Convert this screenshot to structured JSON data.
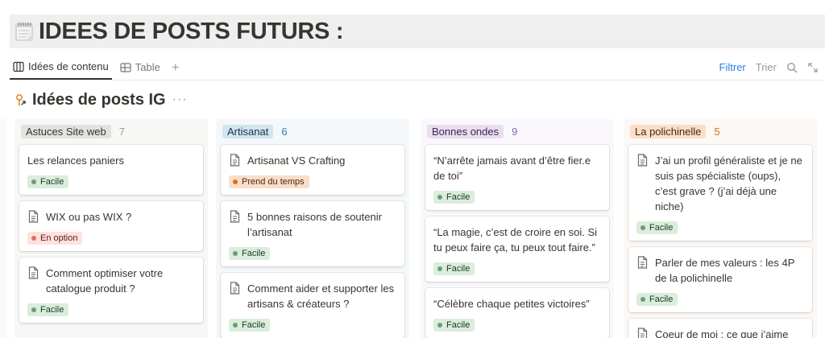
{
  "page": {
    "title": "IDEES DE POSTS FUTURS :",
    "icon": "notepad-icon"
  },
  "views": {
    "tabs": [
      {
        "label": "Idées de contenu",
        "icon": "board-icon",
        "active": true
      },
      {
        "label": "Table",
        "icon": "table-icon",
        "active": false
      }
    ],
    "add_label": "+",
    "filter_label": "Filtrer",
    "sort_label": "Trier"
  },
  "section": {
    "title": "Idées de posts IG",
    "icon": "pointer-tap-icon",
    "more": "···"
  },
  "colors": {
    "accent_blue": "#2383e2",
    "facile_bg": "#dbeddb",
    "facile_dot": "#6c9b7d",
    "option_bg": "#ffe2dd",
    "option_dot": "#e16f64",
    "temps_bg": "#fadec9",
    "temps_dot": "#d9730d"
  },
  "columns": [
    {
      "label": "Astuces Site web",
      "count": "7",
      "label_bg": "#e3e2e0",
      "label_color": "#37352f",
      "count_color": "#9b9a97",
      "bg": "#f7f7f5",
      "cards": [
        {
          "title": "Les relances paniers",
          "doc": false,
          "tag": "Facile",
          "tag_type": "facile"
        },
        {
          "title": "WIX ou pas WIX ?",
          "doc": true,
          "tag": "En option",
          "tag_type": "option"
        },
        {
          "title": "Comment optimiser votre catalogue produit ?",
          "doc": true,
          "tag": "Facile",
          "tag_type": "facile"
        }
      ]
    },
    {
      "label": "Artisanat",
      "count": "6",
      "label_bg": "#d3e5ef",
      "label_color": "#183347",
      "count_color": "#337ea9",
      "bg": "#f4f8fa",
      "cards": [
        {
          "title": "Artisanat VS Crafting",
          "doc": true,
          "tag": "Prend du temps",
          "tag_type": "temps"
        },
        {
          "title": "5 bonnes raisons de soutenir l’artisanat",
          "doc": true,
          "tag": "Facile",
          "tag_type": "facile"
        },
        {
          "title": "Comment aider et supporter les artisans & créateurs ?",
          "doc": true,
          "tag": "Facile",
          "tag_type": "facile"
        }
      ]
    },
    {
      "label": "Bonnes ondes",
      "count": "9",
      "label_bg": "#e8deee",
      "label_color": "#412454",
      "count_color": "#9065b0",
      "bg": "#faf8fc",
      "cards": [
        {
          "title": "“N’arrête jamais avant d’être fier.e de toi”",
          "doc": false,
          "tag": "Facile",
          "tag_type": "facile"
        },
        {
          "title": "“La magie, c’est de croire en soi. Si tu peux faire ça, tu peux tout faire.”",
          "doc": false,
          "tag": "Facile",
          "tag_type": "facile"
        },
        {
          "title": "“Célèbre chaque petites victoires”",
          "doc": false,
          "tag": "Facile",
          "tag_type": "facile"
        }
      ]
    },
    {
      "label": "La polichinelle",
      "count": "5",
      "label_bg": "#fadec9",
      "label_color": "#49290e",
      "count_color": "#d9730d",
      "bg": "#fcf8f5",
      "cards": [
        {
          "title": "J’ai un profil généraliste et je ne suis pas spécialiste (oups), c’est grave ? (j’ai déjà une niche)",
          "doc": true,
          "tag": "Facile",
          "tag_type": "facile"
        },
        {
          "title": "Parler de mes valeurs : les 4P de la polichinelle",
          "doc": true,
          "tag": "Facile",
          "tag_type": "facile"
        },
        {
          "title": "Coeur de moi : ce que j’aime",
          "doc": true,
          "tag": "",
          "tag_type": ""
        }
      ]
    }
  ]
}
